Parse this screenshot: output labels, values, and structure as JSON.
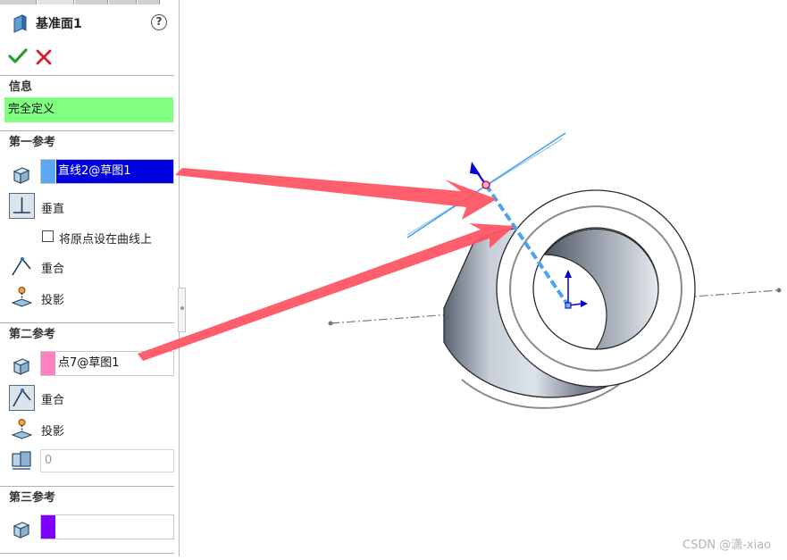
{
  "panel": {
    "title": "基准面1",
    "help_icon": "question-mark-icon",
    "ok_icon": "check-icon",
    "cancel_icon": "close-icon",
    "info": {
      "heading": "信息",
      "status": "完全定义",
      "status_color": "#80ff80"
    },
    "first_reference": {
      "heading": "第一参考",
      "value": "直线2@草图1",
      "swatch_color": "#5aa9f0",
      "options": [
        {
          "label": "垂直",
          "icon": "perpendicular-icon",
          "active": true
        },
        {
          "label": "重合",
          "icon": "coincident-icon",
          "active": false
        },
        {
          "label": "投影",
          "icon": "projection-icon",
          "active": false
        }
      ],
      "checkbox_label": "将原点设在曲线上",
      "checkbox_checked": false
    },
    "second_reference": {
      "heading": "第二参考",
      "value": "点7@草图1",
      "swatch_color": "#ff80c0",
      "options": [
        {
          "label": "重合",
          "icon": "coincident-icon",
          "active": true
        },
        {
          "label": "投影",
          "icon": "projection-icon",
          "active": false
        }
      ],
      "number_value": "0"
    },
    "third_reference": {
      "heading": "第三参考",
      "value": "",
      "swatch_color": "#8000ff"
    }
  },
  "annotation_arrow_color": "#ff5060",
  "watermark": "CSDN @潇-xiao"
}
